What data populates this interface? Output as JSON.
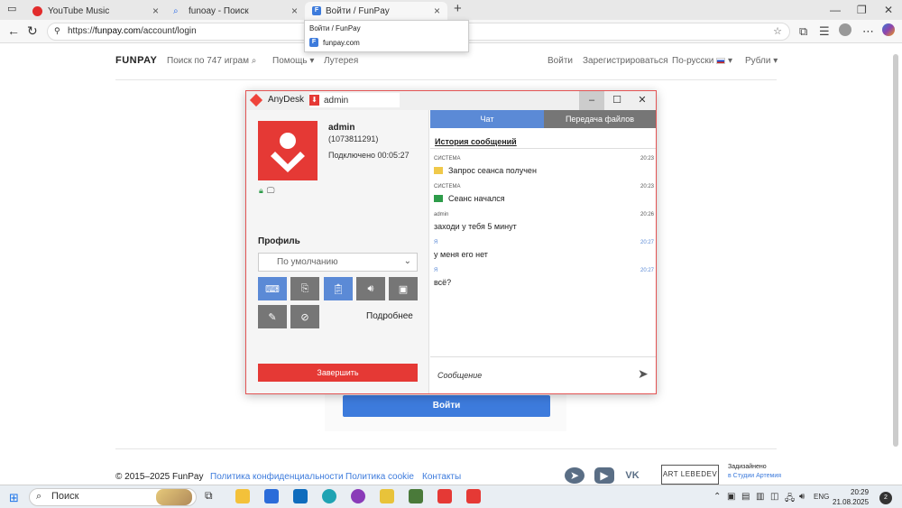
{
  "browser": {
    "tabs": [
      {
        "title": "YouTube Music",
        "icon": "youtube-music-icon",
        "color": "#e22c2c"
      },
      {
        "title": "funoay - Поиск",
        "icon": "search-icon",
        "color": "#2a6ae8"
      },
      {
        "title": "Войти / FunPay",
        "icon": "funpay-icon",
        "color": "#3d7bdc"
      }
    ],
    "url_prefix": "https://",
    "url_host": "funpay.com",
    "url_path": "/account/login",
    "tab_popup": {
      "title": "Войти / FunPay",
      "domain": "funpay.com"
    }
  },
  "site": {
    "logo": "FUNPAY",
    "nav": {
      "search": "Поиск по 747 играм",
      "help": "Помощь",
      "lottery": "Лутерея",
      "login": "Войти",
      "register": "Зарегистрироваться",
      "language": "По-русски",
      "currency": "Рубли"
    },
    "login_button": "Войти",
    "footer": {
      "copyright": "© 2015–2025 FunPay",
      "privacy": "Политика конфиденциальности",
      "cookie": "Политика cookie",
      "contacts": "Контакты",
      "art": "ART LEBEDEV",
      "design_line1": "Задизайнено",
      "design_line2": "в Студии Артемия"
    }
  },
  "anydesk": {
    "app_name": "AnyDesk",
    "address": "admin",
    "user_name": "admin",
    "user_id": "(1073811291)",
    "connected": "Подключено 00:05:27",
    "profile_label": "Профиль",
    "profile_value": "По умолчанию",
    "more": "Подробнее",
    "end_button": "Завершить",
    "tabs": {
      "chat": "Чат",
      "files": "Передача файлов"
    },
    "history_label": "История сообщений",
    "messages": [
      {
        "sender": "СИСТЕМА",
        "time": "20:23",
        "text": "Запрос сеанса получен"
      },
      {
        "sender": "СИСТЕМА",
        "time": "20:23",
        "text": "Сеанс начался"
      },
      {
        "sender": "admin",
        "time": "20:26",
        "text": "заходи у тебя 5 минут"
      },
      {
        "sender": "Я",
        "time": "20:27",
        "text": "у меня его нет"
      },
      {
        "sender": "Я",
        "time": "20:27",
        "text": "всё?"
      }
    ],
    "input_placeholder": "Сообщение",
    "accent": "#e53935",
    "tab_active_color": "#5b8ad6"
  },
  "taskbar": {
    "search": "Поиск",
    "lang": "ENG",
    "time": "20:29",
    "date": "21.08.2025",
    "notifications": "2"
  }
}
